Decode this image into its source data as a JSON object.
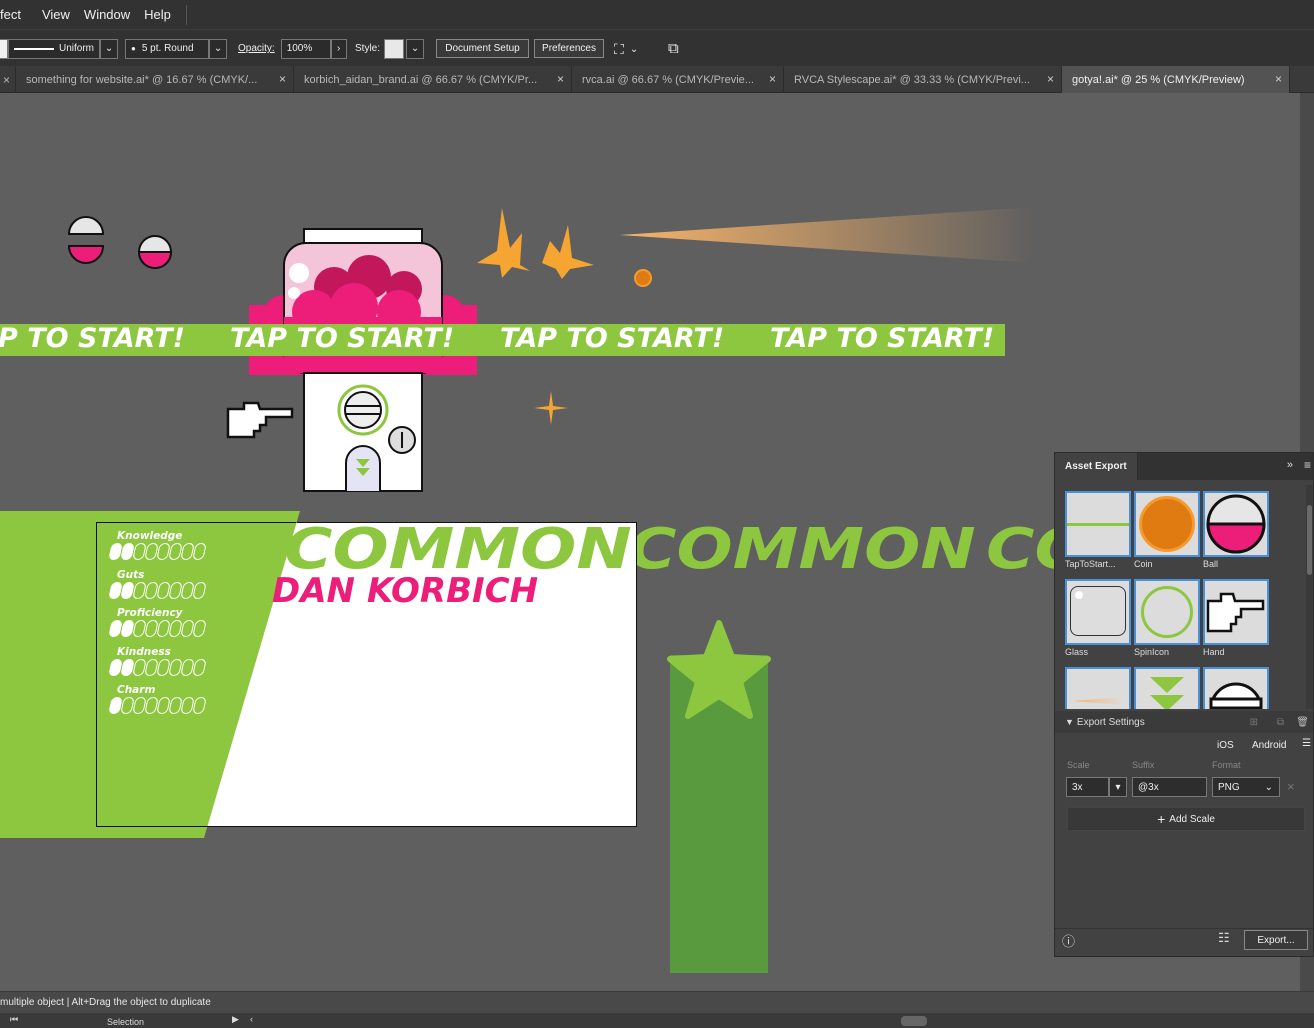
{
  "menu": {
    "items": [
      "fect",
      "View",
      "Window",
      "Help"
    ]
  },
  "control_bar": {
    "stroke_profile": "Uniform",
    "brush": "5 pt. Round",
    "opacity_label": "Opacity:",
    "opacity_value": "100%",
    "style_label": "Style:",
    "document_setup": "Document Setup",
    "preferences": "Preferences"
  },
  "tabs": [
    {
      "label": "something for website.ai* @ 16.67 % (CMYK/...",
      "active": false
    },
    {
      "label": "korbich_aidan_brand.ai @ 66.67 % (CMYK/Pr...",
      "active": false
    },
    {
      "label": "rvca.ai @ 66.67 % (CMYK/Previe...",
      "active": false
    },
    {
      "label": "RVCA Stylescape.ai* @ 33.33 % (CMYK/Previ...",
      "active": false
    },
    {
      "label": "gotya!.ai* @ 25 % (CMYK/Preview)",
      "active": true
    }
  ],
  "artwork": {
    "tap_text": "TAP TO START!",
    "tap_partial": "P TO START!",
    "common_text": "COMMON",
    "common_partial_1": "COMMON",
    "common_partial_3": "CO",
    "name_text": "DAN KORBICH",
    "stats": [
      {
        "label": "Knowledge",
        "filled": 2,
        "total": 8
      },
      {
        "label": "Guts",
        "filled": 2,
        "total": 8
      },
      {
        "label": "Proficiency",
        "filled": 2,
        "total": 8
      },
      {
        "label": "Kindness",
        "filled": 2,
        "total": 8
      },
      {
        "label": "Charm",
        "filled": 1,
        "total": 8
      }
    ]
  },
  "asset_export": {
    "title": "Asset Export",
    "assets": [
      {
        "label": "TapToStart...",
        "icon": "tap-strip-thumb"
      },
      {
        "label": "Coin",
        "icon": "coin-thumb"
      },
      {
        "label": "Ball",
        "icon": "ball-thumb"
      },
      {
        "label": "Glass",
        "icon": "glass-thumb"
      },
      {
        "label": "SpinIcon",
        "icon": "spin-thumb"
      },
      {
        "label": "Hand",
        "icon": "hand-thumb"
      }
    ],
    "export_settings": "Export Settings",
    "ios": "iOS",
    "android": "Android",
    "scale_label": "Scale",
    "suffix_label": "Suffix",
    "format_label": "Format",
    "scale_value": "3x",
    "suffix_value": "@3x",
    "format_value": "PNG",
    "add_scale": "Add Scale",
    "export_button": "Export..."
  },
  "status_bar": {
    "hint": "multiple object  |  Alt+Drag the object to duplicate",
    "tool": "Selection"
  },
  "colors": {
    "green": "#8dc63f",
    "pink": "#ec1e79",
    "orange": "#f7a532",
    "dark_green": "#5a9a3e"
  }
}
